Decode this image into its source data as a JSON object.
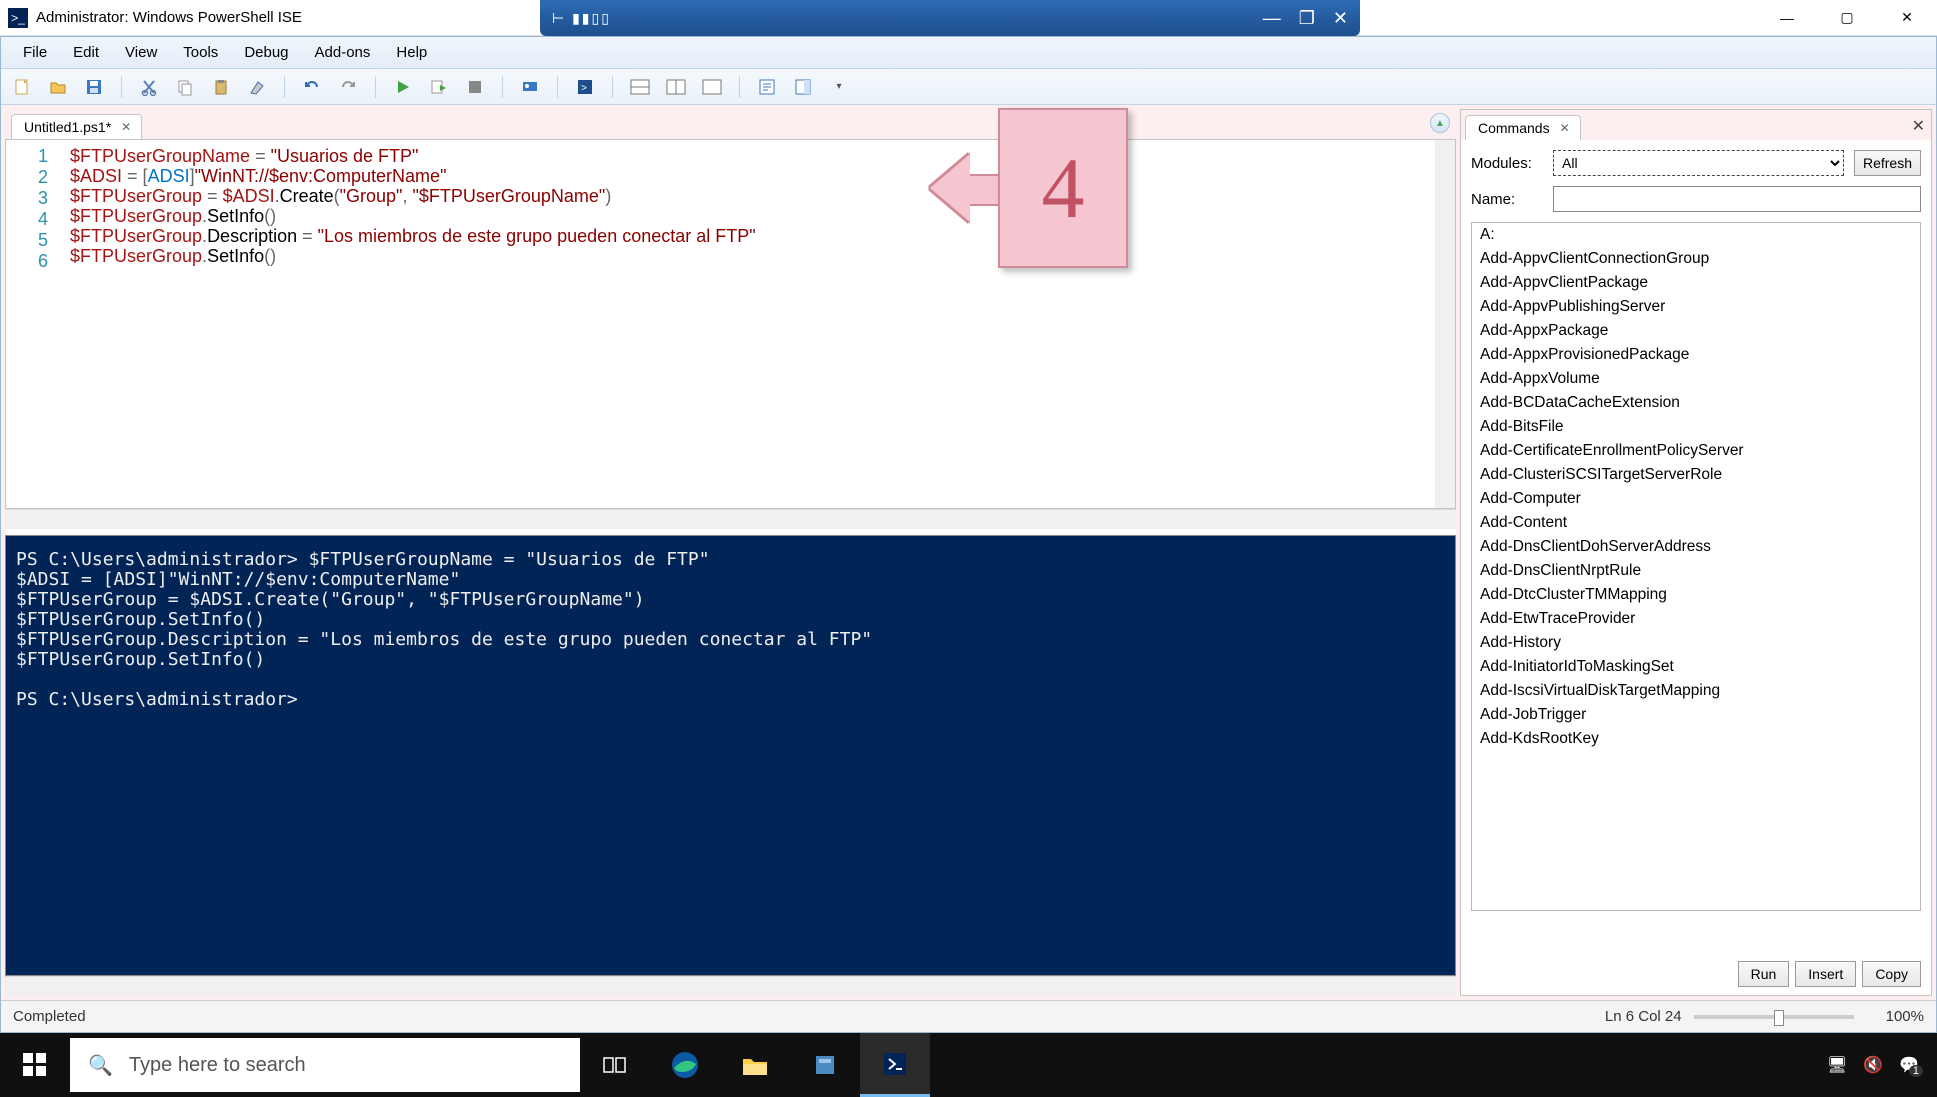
{
  "window": {
    "title": "Administrator: Windows PowerShell ISE"
  },
  "menubar": [
    "File",
    "Edit",
    "View",
    "Tools",
    "Debug",
    "Add-ons",
    "Help"
  ],
  "tab": {
    "name": "Untitled1.ps1*"
  },
  "editor": {
    "lines": [
      "1",
      "2",
      "3",
      "4",
      "5",
      "6"
    ],
    "tokens": [
      [
        {
          "t": "var",
          "v": "$FTPUserGroupName"
        },
        {
          "t": "op",
          "v": " = "
        },
        {
          "t": "str",
          "v": "\"Usuarios de FTP\""
        }
      ],
      [
        {
          "t": "var",
          "v": "$ADSI"
        },
        {
          "t": "op",
          "v": " = "
        },
        {
          "t": "op",
          "v": "["
        },
        {
          "t": "type",
          "v": "ADSI"
        },
        {
          "t": "op",
          "v": "]"
        },
        {
          "t": "str",
          "v": "\"WinNT://$env:ComputerName\""
        }
      ],
      [
        {
          "t": "var",
          "v": "$FTPUserGroup"
        },
        {
          "t": "op",
          "v": " = "
        },
        {
          "t": "var",
          "v": "$ADSI"
        },
        {
          "t": "op",
          "v": "."
        },
        {
          "t": "mem",
          "v": "Create"
        },
        {
          "t": "op",
          "v": "("
        },
        {
          "t": "str",
          "v": "\"Group\""
        },
        {
          "t": "op",
          "v": ", "
        },
        {
          "t": "str",
          "v": "\"$FTPUserGroupName\""
        },
        {
          "t": "op",
          "v": ")"
        }
      ],
      [
        {
          "t": "var",
          "v": "$FTPUserGroup"
        },
        {
          "t": "op",
          "v": "."
        },
        {
          "t": "mem",
          "v": "SetInfo"
        },
        {
          "t": "op",
          "v": "()"
        }
      ],
      [
        {
          "t": "var",
          "v": "$FTPUserGroup"
        },
        {
          "t": "op",
          "v": "."
        },
        {
          "t": "mem",
          "v": "Description"
        },
        {
          "t": "op",
          "v": " = "
        },
        {
          "t": "str",
          "v": "\"Los miembros de este grupo pueden conectar al FTP\""
        }
      ],
      [
        {
          "t": "var",
          "v": "$FTPUserGroup"
        },
        {
          "t": "op",
          "v": "."
        },
        {
          "t": "mem",
          "v": "SetInfo"
        },
        {
          "t": "op",
          "v": "()"
        }
      ]
    ]
  },
  "console_text": "PS C:\\Users\\administrador> $FTPUserGroupName = \"Usuarios de FTP\"\n$ADSI = [ADSI]\"WinNT://$env:ComputerName\"\n$FTPUserGroup = $ADSI.Create(\"Group\", \"$FTPUserGroupName\")\n$FTPUserGroup.SetInfo()\n$FTPUserGroup.Description = \"Los miembros de este grupo pueden conectar al FTP\"\n$FTPUserGroup.SetInfo()\n\nPS C:\\Users\\administrador> ",
  "commands_pane": {
    "title": "Commands",
    "modules_label": "Modules:",
    "modules_value": "All",
    "refresh": "Refresh",
    "name_label": "Name:",
    "name_value": "",
    "list": [
      "A:",
      "Add-AppvClientConnectionGroup",
      "Add-AppvClientPackage",
      "Add-AppvPublishingServer",
      "Add-AppxPackage",
      "Add-AppxProvisionedPackage",
      "Add-AppxVolume",
      "Add-BCDataCacheExtension",
      "Add-BitsFile",
      "Add-CertificateEnrollmentPolicyServer",
      "Add-ClusteriSCSITargetServerRole",
      "Add-Computer",
      "Add-Content",
      "Add-DnsClientDohServerAddress",
      "Add-DnsClientNrptRule",
      "Add-DtcClusterTMMapping",
      "Add-EtwTraceProvider",
      "Add-History",
      "Add-InitiatorIdToMaskingSet",
      "Add-IscsiVirtualDiskTargetMapping",
      "Add-JobTrigger",
      "Add-KdsRootKey"
    ],
    "run": "Run",
    "insert": "Insert",
    "copy": "Copy"
  },
  "status": {
    "left": "Completed",
    "pos": "Ln 6  Col 24",
    "zoom": "100%"
  },
  "taskbar": {
    "search_placeholder": "Type here to search"
  },
  "callout": {
    "number": "4"
  }
}
